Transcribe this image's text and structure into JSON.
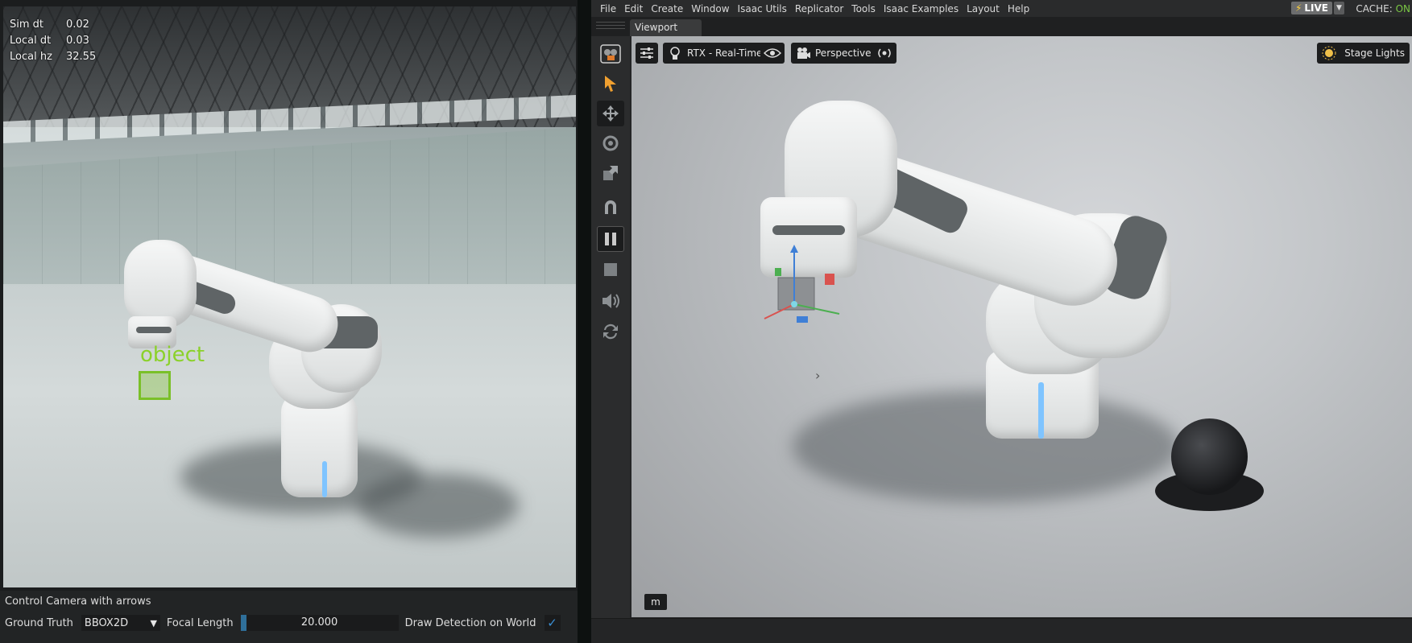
{
  "left_panel": {
    "stats": [
      {
        "label": "Sim dt",
        "value": "0.02"
      },
      {
        "label": "Local dt",
        "value": "0.03"
      },
      {
        "label": "Local hz",
        "value": "32.55"
      }
    ],
    "detection_label": "object",
    "controls": {
      "hint": "Control Camera with arrows",
      "ground_truth_label": "Ground Truth",
      "ground_truth_value": "BBOX2D",
      "focal_length_label": "Focal Length",
      "focal_length_value": "20.000",
      "focal_length_fill_fraction": 0.04,
      "draw_detection_label": "Draw Detection on World",
      "draw_detection_checked": true
    }
  },
  "right_panel": {
    "menu": [
      "File",
      "Edit",
      "Create",
      "Window",
      "Isaac Utils",
      "Replicator",
      "Tools",
      "Isaac Examples",
      "Layout",
      "Help"
    ],
    "live_label": "LIVE",
    "cache_label": "CACHE:",
    "cache_state": "ON",
    "tab_label": "Viewport",
    "viewport": {
      "renderer_label": "RTX - Real-Time",
      "camera_label": "Perspective",
      "lights_label": "Stage Lights",
      "units_label": "m"
    },
    "toolbar_icons": [
      "camera-icon",
      "select-icon",
      "move-icon",
      "rotate-icon",
      "scale-icon",
      "snap-icon",
      "pause-icon",
      "stop-icon",
      "audio-icon",
      "refresh-icon"
    ],
    "accent_color": "#f0a030",
    "cache_on_color": "#7ac743"
  }
}
